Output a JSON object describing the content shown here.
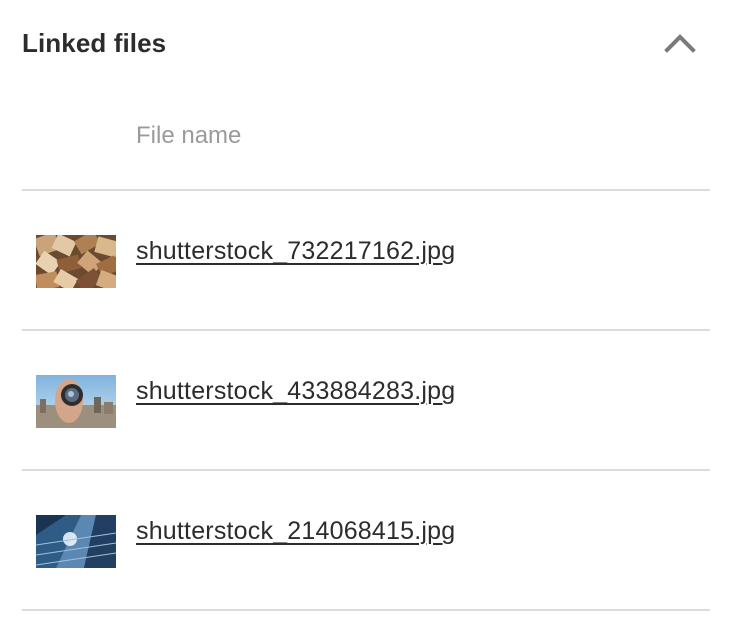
{
  "panel": {
    "title": "Linked files",
    "collapse_icon": "chevron-up-icon"
  },
  "table": {
    "column_header": "File name",
    "files": [
      {
        "name": "shutterstock_732217162.jpg",
        "thumbnail": "stacked-books-image"
      },
      {
        "name": "shutterstock_433884283.jpg",
        "thumbnail": "lens-over-city-image"
      },
      {
        "name": "shutterstock_214068415.jpg",
        "thumbnail": "glass-skyscraper-image"
      }
    ]
  },
  "colors": {
    "text": "#2c2c2c",
    "muted": "#9a9a9a",
    "divider": "#dcdcdc",
    "icon": "#7a7a7a"
  }
}
